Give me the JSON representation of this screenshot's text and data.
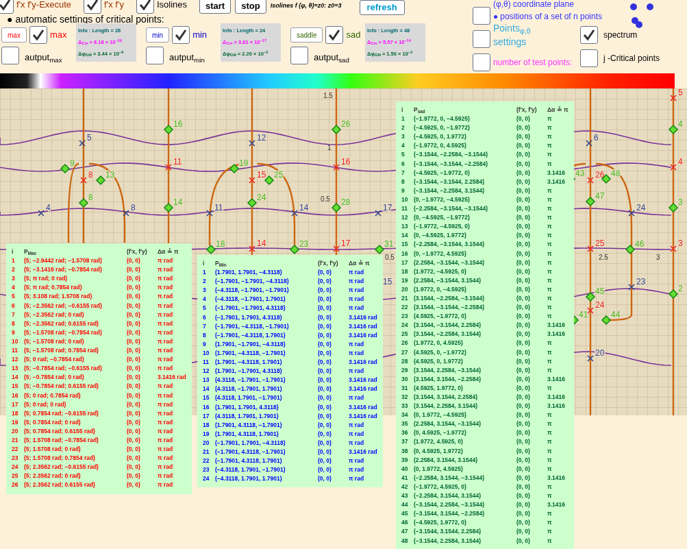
{
  "toolbar": {
    "row1": [
      {
        "kind": "check",
        "label": "f'x f'y-Execute",
        "checked": true,
        "color": "#993300"
      },
      {
        "kind": "check",
        "label": "f'x f'y",
        "checked": true,
        "color": "#993300"
      },
      {
        "kind": "check",
        "label": "Isolines",
        "checked": true,
        "color": "#000000"
      },
      {
        "kind": "button",
        "label": "start"
      },
      {
        "kind": "button",
        "label": "stop"
      },
      {
        "kind": "note",
        "label": "Isolines f (φ, θ)=z0: z0=3"
      },
      {
        "kind": "refresh",
        "label": "refresh"
      }
    ],
    "auto_heading": {
      "bullet": "●",
      "label": "automatic settings of critical points:"
    },
    "groups": [
      {
        "kind": "max",
        "button": "max",
        "checked": true,
        "label": "max",
        "output_label": "autput$_{max}$",
        "output_checked": false,
        "info": {
          "title": "Info : Length = 26",
          "cm": "Δ$_{Cm}$ = 6.18 × 10$^{−16}$",
          "gm": "Δφ$_{GM}$ = 3.44 × 10$^{−9}$"
        }
      },
      {
        "kind": "min",
        "button": "min",
        "checked": true,
        "label": "min",
        "output_label": "autput$_{min}$",
        "output_checked": false,
        "info": {
          "title": "Info : Length = 24",
          "cm": "Δ$_{Cm}$ = 3.81 × 10$^{−17}$",
          "gm": "Δφ$_{GM}$ = 2.20 × 10$^{−2}$"
        }
      },
      {
        "kind": "sad",
        "button": "saddle",
        "checked": true,
        "label": "sad",
        "output_label": "autput$_{sad}$",
        "output_checked": false,
        "info": {
          "title": "Info : Length = 48",
          "cm": "Δ$_{Cm}$ = 5.57 × 10$^{−14}$",
          "gm": "Δφ$_{GM}$ = 1.50 × 10$^{−2}$"
        }
      }
    ],
    "right": {
      "coordinate_plane": "(φ,θ) coordinate plane",
      "positions_bullet": "●",
      "positions": "positions of a set of n points",
      "points_checked": false,
      "points": "Points$_{φ,θ}$",
      "settings_checked": false,
      "settings": "settings",
      "spectrum_checked": true,
      "spectrum": "spectrum",
      "test_points_checked": false,
      "test_points": "number of test points:",
      "critical_checked": false,
      "critical": "j -Critical points"
    }
  },
  "plot": {
    "axis_labels": [
      "1.5",
      "1",
      "0.5",
      "0.5",
      "2.5",
      "3"
    ],
    "points": [
      {
        "label": "5",
        "kind": "min"
      },
      {
        "label": "12",
        "kind": "min"
      },
      {
        "label": "6",
        "kind": "min"
      },
      {
        "label": "4",
        "kind": "min"
      },
      {
        "label": "8",
        "kind": "min"
      },
      {
        "label": "11",
        "kind": "min"
      },
      {
        "label": "14",
        "kind": "min"
      },
      {
        "label": "17",
        "kind": "min"
      },
      {
        "label": "24",
        "kind": "min"
      },
      {
        "label": "15",
        "kind": "min"
      },
      {
        "label": "23",
        "kind": "min"
      },
      {
        "label": "20",
        "kind": "min"
      },
      {
        "label": "8",
        "kind": "max"
      },
      {
        "label": "11",
        "kind": "max"
      },
      {
        "label": "15",
        "kind": "max"
      },
      {
        "label": "16",
        "kind": "max"
      },
      {
        "label": "14",
        "kind": "max"
      },
      {
        "label": "17",
        "kind": "max"
      },
      {
        "label": "26",
        "kind": "max"
      },
      {
        "label": "25",
        "kind": "max"
      },
      {
        "label": "24",
        "kind": "max"
      },
      {
        "label": "5",
        "kind": "max"
      },
      {
        "label": "4",
        "kind": "max"
      },
      {
        "label": "3",
        "kind": "max"
      },
      {
        "label": "16",
        "kind": "sad"
      },
      {
        "label": "26",
        "kind": "sad"
      },
      {
        "label": "4",
        "kind": "sad"
      },
      {
        "label": "9",
        "kind": "sad"
      },
      {
        "label": "13",
        "kind": "sad"
      },
      {
        "label": "19",
        "kind": "sad"
      },
      {
        "label": "25",
        "kind": "sad"
      },
      {
        "label": "43",
        "kind": "sad"
      },
      {
        "label": "48",
        "kind": "sad"
      },
      {
        "label": "8",
        "kind": "sad"
      },
      {
        "label": "24",
        "kind": "sad"
      },
      {
        "label": "47",
        "kind": "sad"
      },
      {
        "label": "14",
        "kind": "sad"
      },
      {
        "label": "28",
        "kind": "sad"
      },
      {
        "label": "3",
        "kind": "sad"
      },
      {
        "label": "18",
        "kind": "sad"
      },
      {
        "label": "23",
        "kind": "sad"
      },
      {
        "label": "31",
        "kind": "sad"
      },
      {
        "label": "46",
        "kind": "sad"
      },
      {
        "label": "45",
        "kind": "sad"
      },
      {
        "label": "41",
        "kind": "sad"
      },
      {
        "label": "44",
        "kind": "sad"
      },
      {
        "label": "2",
        "kind": "sad"
      }
    ]
  },
  "tables": [
    {
      "kind": "max",
      "header": [
        "i",
        "P$_{Max}$",
        "(f′x, f′y)",
        "Δα ≟ π"
      ],
      "rows": [
        {
          "i": "1",
          "p": "(5; −2.9442 rad; −1.5708 rad)",
          "f": "(0, 0)",
          "d": "π rad"
        },
        {
          "i": "2",
          "p": "(5; −3.1416 rad; −0.7854 rad)",
          "f": "(0, 0)",
          "d": "π rad"
        },
        {
          "i": "3",
          "p": "(5; π rad; 0 rad)",
          "f": "(0, 0)",
          "d": "π rad"
        },
        {
          "i": "4",
          "p": "(5; π rad; 0.7854 rad)",
          "f": "(0, 0)",
          "d": "π rad"
        },
        {
          "i": "5",
          "p": "(5; 3.108 rad; 1.5708 rad)",
          "f": "(0, 0)",
          "d": "π rad"
        },
        {
          "i": "6",
          "p": "(5; −2.3562 rad; −0.6155 rad)",
          "f": "(0, 0)",
          "d": "π rad"
        },
        {
          "i": "7",
          "p": "(5; −2.3562 rad; 0 rad)",
          "f": "(0, 0)",
          "d": "π rad"
        },
        {
          "i": "8",
          "p": "(5; −2.3562 rad; 0.6155 rad)",
          "f": "(0, 0)",
          "d": "π rad"
        },
        {
          "i": "9",
          "p": "(5; −1.5708 rad; −0.7854 rad)",
          "f": "(0, 0)",
          "d": "π rad"
        },
        {
          "i": "10",
          "p": "(5; −1.5708 rad; 0 rad)",
          "f": "(0, 0)",
          "d": "π rad"
        },
        {
          "i": "11",
          "p": "(5; −1.5708 rad; 0.7854 rad)",
          "f": "(0, 0)",
          "d": "π rad"
        },
        {
          "i": "12",
          "p": "(5; 0 rad; −0.7854 rad)",
          "f": "(0, 0)",
          "d": "π rad"
        },
        {
          "i": "13",
          "p": "(5; −0.7854 rad; −0.6155 rad)",
          "f": "(0, 0)",
          "d": "π rad"
        },
        {
          "i": "14",
          "p": "(5; −0.7854 rad; 0 rad)",
          "f": "(0, 0)",
          "d": "3.1416 rad"
        },
        {
          "i": "15",
          "p": "(5; −0.7854 rad; 0.6155 rad)",
          "f": "(0, 0)",
          "d": "π rad"
        },
        {
          "i": "16",
          "p": "(5; 0 rad; 0.7854 rad)",
          "f": "(0, 0)",
          "d": "π rad"
        },
        {
          "i": "17",
          "p": "(5; 0 rad; 0 rad)",
          "f": "(0, 0)",
          "d": "π rad"
        },
        {
          "i": "18",
          "p": "(5; 0.7854 rad; −0.6155 rad)",
          "f": "(0, 0)",
          "d": "π rad"
        },
        {
          "i": "19",
          "p": "(5; 0.7854 rad; 0 rad)",
          "f": "(0, 0)",
          "d": "π rad"
        },
        {
          "i": "20",
          "p": "(5; 0.7854 rad; 0.6155 rad)",
          "f": "(0, 0)",
          "d": "π rad"
        },
        {
          "i": "21",
          "p": "(5; 1.5708 rad; −0.7854 rad)",
          "f": "(0, 0)",
          "d": "π rad"
        },
        {
          "i": "22",
          "p": "(5; 1.5708 rad; 0 rad)",
          "f": "(0, 0)",
          "d": "π rad"
        },
        {
          "i": "23",
          "p": "(5; 1.5708 rad; 0.7854 rad)",
          "f": "(0, 0)",
          "d": "π rad"
        },
        {
          "i": "24",
          "p": "(5; 2.3562 rad; −0.6155 rad)",
          "f": "(0, 0)",
          "d": "π rad"
        },
        {
          "i": "25",
          "p": "(5; 2.3562 rad; 0 rad)",
          "f": "(0, 0)",
          "d": "π rad"
        },
        {
          "i": "26",
          "p": "(5; 2.3562 rad; 0.6155 rad)",
          "f": "(0, 0)",
          "d": "π rad"
        }
      ]
    },
    {
      "kind": "min",
      "header": [
        "i",
        "P$_{Min}$",
        "(f′x, f′y)",
        "Δα ≟ π"
      ],
      "rows": [
        {
          "i": "1",
          "p": "(1.7901, 1.7901, −4.3118)",
          "f": "(0, 0)",
          "d": "π rad"
        },
        {
          "i": "2",
          "p": "(−1.7901, −1.7901, −4.3118)",
          "f": "(0, 0)",
          "d": "π rad"
        },
        {
          "i": "3",
          "p": "(−4.3118, −1.7901, −1.7901)",
          "f": "(0, 0)",
          "d": "π rad"
        },
        {
          "i": "4",
          "p": "(−4.3118, −1.7901, 1.7901)",
          "f": "(0, 0)",
          "d": "π rad"
        },
        {
          "i": "5",
          "p": "(−1.7901, −1.7901, 4.3118)",
          "f": "(0, 0)",
          "d": "π rad"
        },
        {
          "i": "6",
          "p": "(−1.7901, 1.7901, 4.3118)",
          "f": "(0, 0)",
          "d": "3.1416 rad"
        },
        {
          "i": "7",
          "p": "(−1.7901, −4.3118, −1.7901)",
          "f": "(0, 0)",
          "d": "3.1416 rad"
        },
        {
          "i": "8",
          "p": "(−1.7901, −4.3118, 1.7901)",
          "f": "(0, 0)",
          "d": "3.1416 rad"
        },
        {
          "i": "9",
          "p": "(1.7901, −1.7901, −4.3118)",
          "f": "(0, 0)",
          "d": "π rad"
        },
        {
          "i": "10",
          "p": "(1.7901, −4.3118, −1.7901)",
          "f": "(0, 0)",
          "d": "π rad"
        },
        {
          "i": "11",
          "p": "(1.7901, −4.3118, 1.7901)",
          "f": "(0, 0)",
          "d": "3.1416 rad"
        },
        {
          "i": "12",
          "p": "(1.7901, −1.7901, 4.3118)",
          "f": "(0, 0)",
          "d": "π rad"
        },
        {
          "i": "13",
          "p": "(4.3118, −1.7901, −1.7901)",
          "f": "(0, 0)",
          "d": "3.1416 rad"
        },
        {
          "i": "14",
          "p": "(4.3118, −1.7901, 1.7901)",
          "f": "(0, 0)",
          "d": "3.1416 rad"
        },
        {
          "i": "15",
          "p": "(4.3118, 1.7901, −1.7901)",
          "f": "(0, 0)",
          "d": "π rad"
        },
        {
          "i": "16",
          "p": "(1.7901, 1.7901, 4.3118)",
          "f": "(0, 0)",
          "d": "3.1416 rad"
        },
        {
          "i": "17",
          "p": "(4.3118, 1.7901, 1.7901)",
          "f": "(0, 0)",
          "d": "3.1416 rad"
        },
        {
          "i": "18",
          "p": "(1.7901, 4.3118, −1.7901)",
          "f": "(0, 0)",
          "d": "π rad"
        },
        {
          "i": "19",
          "p": "(1.7901, 4.3118, 1.7901)",
          "f": "(0, 0)",
          "d": "π rad"
        },
        {
          "i": "20",
          "p": "(−1.7901, 1.7901, −4.3118)",
          "f": "(0, 0)",
          "d": "π rad"
        },
        {
          "i": "21",
          "p": "(−1.7901, 4.3118, −1.7901)",
          "f": "(0, 0)",
          "d": "3.1416 rad"
        },
        {
          "i": "22",
          "p": "(−1.7901, 4.3118, 1.7901)",
          "f": "(0, 0)",
          "d": "π rad"
        },
        {
          "i": "23",
          "p": "(−4.3118, 1.7901, −1.7901)",
          "f": "(0, 0)",
          "d": "π rad"
        },
        {
          "i": "24",
          "p": "(−4.3118, 1.7901, 1.7901)",
          "f": "(0, 0)",
          "d": "π rad"
        }
      ]
    },
    {
      "kind": "sad",
      "header": [
        "i",
        "P$_{sad}$",
        "(f′x, f′y)",
        "Δα ≟ π"
      ],
      "rows": [
        {
          "i": "1",
          "p": "(−1.9772, 0, −4.5925)",
          "f": "(0, 0)",
          "d": "π"
        },
        {
          "i": "2",
          "p": "(−4.5925, 0, −1.9772)",
          "f": "(0, 0)",
          "d": "π"
        },
        {
          "i": "3",
          "p": "(−4.5925, 0, 1.9772)",
          "f": "(0, 0)",
          "d": "π"
        },
        {
          "i": "4",
          "p": "(−1.9772, 0, 4.5925)",
          "f": "(0, 0)",
          "d": "π"
        },
        {
          "i": "5",
          "p": "(−3.1544, −2.2584, −3.1544)",
          "f": "(0, 0)",
          "d": "π"
        },
        {
          "i": "6",
          "p": "(−3.1544, −3.1544, −2.2584)",
          "f": "(0, 0)",
          "d": "π"
        },
        {
          "i": "7",
          "p": "(−4.5925, −1.9772, 0)",
          "f": "(0, 0)",
          "d": "3.1416"
        },
        {
          "i": "8",
          "p": "(−3.1544, −3.1544, 2.2584)",
          "f": "(0, 0)",
          "d": "3.1416"
        },
        {
          "i": "9",
          "p": "(−3.1544, −2.2584, 3.1544)",
          "f": "(0, 0)",
          "d": "π"
        },
        {
          "i": "10",
          "p": "(0, −1.9772, −4.5925)",
          "f": "(0, 0)",
          "d": "π"
        },
        {
          "i": "11",
          "p": "(−2.2584, −3.1544, −3.1544)",
          "f": "(0, 0)",
          "d": "π"
        },
        {
          "i": "12",
          "p": "(0, −4.5925, −1.9772)",
          "f": "(0, 0)",
          "d": "π"
        },
        {
          "i": "13",
          "p": "(−1.9772, −4.5925, 0)",
          "f": "(0, 0)",
          "d": "π"
        },
        {
          "i": "14",
          "p": "(0, −4.5925, 1.9772)",
          "f": "(0, 0)",
          "d": "π"
        },
        {
          "i": "15",
          "p": "(−2.2584, −3.1544, 3.1544)",
          "f": "(0, 0)",
          "d": "π"
        },
        {
          "i": "16",
          "p": "(0, −1.9772, 4.5925)",
          "f": "(0, 0)",
          "d": "π"
        },
        {
          "i": "17",
          "p": "(2.2584, −3.1544, −3.1544)",
          "f": "(0, 0)",
          "d": "π"
        },
        {
          "i": "18",
          "p": "(1.9772, −4.5925, 0)",
          "f": "(0, 0)",
          "d": "π"
        },
        {
          "i": "19",
          "p": "(2.2584, −3.1544, 3.1544)",
          "f": "(0, 0)",
          "d": "π"
        },
        {
          "i": "20",
          "p": "(1.9772, 0, −4.5925)",
          "f": "(0, 0)",
          "d": "π"
        },
        {
          "i": "21",
          "p": "(3.1544, −2.2584, −3.1544)",
          "f": "(0, 0)",
          "d": "π"
        },
        {
          "i": "22",
          "p": "(3.1544, −3.1544, −2.2584)",
          "f": "(0, 0)",
          "d": "π"
        },
        {
          "i": "23",
          "p": "(4.5925, −1.9772, 0)",
          "f": "(0, 0)",
          "d": "π"
        },
        {
          "i": "24",
          "p": "(3.1544, −3.1544, 2.2584)",
          "f": "(0, 0)",
          "d": "3.1416"
        },
        {
          "i": "25",
          "p": "(3.1544, −2.2584, 3.1544)",
          "f": "(0, 0)",
          "d": "3.1416"
        },
        {
          "i": "26",
          "p": "(1.9772, 0, 4.5925)",
          "f": "(0, 0)",
          "d": "π"
        },
        {
          "i": "27",
          "p": "(4.5925, 0, −1.9772)",
          "f": "(0, 0)",
          "d": "π"
        },
        {
          "i": "28",
          "p": "(4.5925, 0, 1.9772)",
          "f": "(0, 0)",
          "d": "π"
        },
        {
          "i": "29",
          "p": "(3.1544, 2.2584, −3.1544)",
          "f": "(0, 0)",
          "d": "π"
        },
        {
          "i": "30",
          "p": "(3.1544, 3.1544, −2.2584)",
          "f": "(0, 0)",
          "d": "3.1416"
        },
        {
          "i": "31",
          "p": "(4.5925, 1.9772, 0)",
          "f": "(0, 0)",
          "d": "π"
        },
        {
          "i": "32",
          "p": "(3.1544, 3.1544, 2.2584)",
          "f": "(0, 0)",
          "d": "3.1416"
        },
        {
          "i": "33",
          "p": "(3.1544, 2.2584, 3.1544)",
          "f": "(0, 0)",
          "d": "3.1416"
        },
        {
          "i": "34",
          "p": "(0, 1.9772, −4.5925)",
          "f": "(0, 0)",
          "d": "π"
        },
        {
          "i": "35",
          "p": "(2.2584, 3.1544, −3.1544)",
          "f": "(0, 0)",
          "d": "π"
        },
        {
          "i": "36",
          "p": "(0, 4.5925, −1.9772)",
          "f": "(0, 0)",
          "d": "π"
        },
        {
          "i": "37",
          "p": "(1.9772, 4.5925, 0)",
          "f": "(0, 0)",
          "d": "π"
        },
        {
          "i": "38",
          "p": "(0, 4.5925, 1.9772)",
          "f": "(0, 0)",
          "d": "π"
        },
        {
          "i": "39",
          "p": "(2.2584, 3.1544, 3.1544)",
          "f": "(0, 0)",
          "d": "π"
        },
        {
          "i": "40",
          "p": "(0, 1.9772, 4.5925)",
          "f": "(0, 0)",
          "d": "π"
        },
        {
          "i": "41",
          "p": "(−2.2584, 3.1544, −3.1544)",
          "f": "(0, 0)",
          "d": "3.1416"
        },
        {
          "i": "42",
          "p": "(−1.9772, 4.5925, 0)",
          "f": "(0, 0)",
          "d": "π"
        },
        {
          "i": "43",
          "p": "(−2.2584, 3.1544, 3.1544)",
          "f": "(0, 0)",
          "d": "π"
        },
        {
          "i": "44",
          "p": "(−3.1544, 2.2584, −3.1544)",
          "f": "(0, 0)",
          "d": "3.1416"
        },
        {
          "i": "45",
          "p": "(−3.1544, 3.1544, −2.2584)",
          "f": "(0, 0)",
          "d": "π"
        },
        {
          "i": "46",
          "p": "(−4.5925, 1.9772, 0)",
          "f": "(0, 0)",
          "d": "π"
        },
        {
          "i": "47",
          "p": "(−3.1544, 3.1544, 2.2584)",
          "f": "(0, 0)",
          "d": "π"
        },
        {
          "i": "48",
          "p": "(−3.1544, 2.2584, 3.1544)",
          "f": "(0, 0)",
          "d": "π"
        }
      ]
    }
  ]
}
